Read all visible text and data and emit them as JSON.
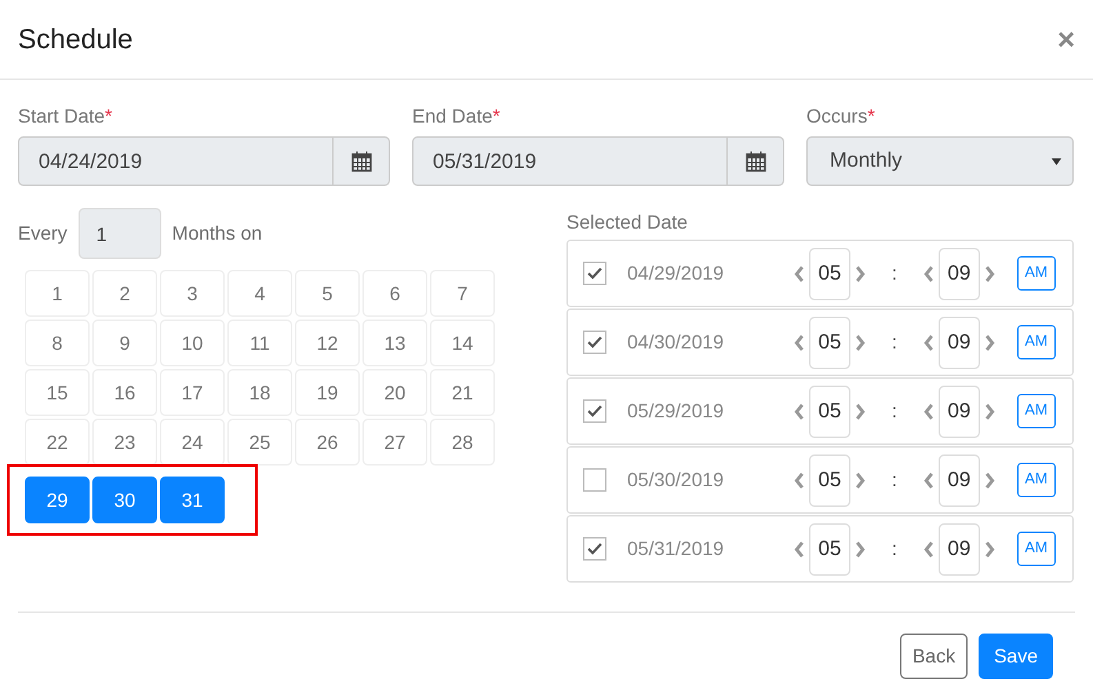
{
  "window": {
    "title": "Schedule",
    "close": "×"
  },
  "fields": [
    {
      "kind": "date",
      "label": "Start Date",
      "required_mark": "*",
      "value": "04/24/2019"
    },
    {
      "kind": "date",
      "label": "End Date",
      "required_mark": "*",
      "value": "05/31/2019"
    },
    {
      "kind": "select",
      "label": "Occurs",
      "required_mark": "*",
      "value": "Monthly"
    }
  ],
  "every": {
    "prefix": "Every",
    "value": "1",
    "suffix": "Months on"
  },
  "calendar": {
    "highlight_selected": true,
    "days": [
      {
        "label": "1",
        "selected": false
      },
      {
        "label": "2",
        "selected": false
      },
      {
        "label": "3",
        "selected": false
      },
      {
        "label": "4",
        "selected": false
      },
      {
        "label": "5",
        "selected": false
      },
      {
        "label": "6",
        "selected": false
      },
      {
        "label": "7",
        "selected": false
      },
      {
        "label": "8",
        "selected": false
      },
      {
        "label": "9",
        "selected": false
      },
      {
        "label": "10",
        "selected": false
      },
      {
        "label": "11",
        "selected": false
      },
      {
        "label": "12",
        "selected": false
      },
      {
        "label": "13",
        "selected": false
      },
      {
        "label": "14",
        "selected": false
      },
      {
        "label": "15",
        "selected": false
      },
      {
        "label": "16",
        "selected": false
      },
      {
        "label": "17",
        "selected": false
      },
      {
        "label": "18",
        "selected": false
      },
      {
        "label": "19",
        "selected": false
      },
      {
        "label": "20",
        "selected": false
      },
      {
        "label": "21",
        "selected": false
      },
      {
        "label": "22",
        "selected": false
      },
      {
        "label": "23",
        "selected": false
      },
      {
        "label": "24",
        "selected": false
      },
      {
        "label": "25",
        "selected": false
      },
      {
        "label": "26",
        "selected": false
      },
      {
        "label": "27",
        "selected": false
      },
      {
        "label": "28",
        "selected": false
      },
      {
        "label": "29",
        "selected": true
      },
      {
        "label": "30",
        "selected": true
      },
      {
        "label": "31",
        "selected": true
      }
    ]
  },
  "selected_dates": {
    "title": "Selected Date",
    "rows": [
      {
        "checked": true,
        "date": "04/29/2019",
        "hour": "05",
        "separator": ":",
        "minute": "09",
        "period": "AM"
      },
      {
        "checked": true,
        "date": "04/30/2019",
        "hour": "05",
        "separator": ":",
        "minute": "09",
        "period": "AM"
      },
      {
        "checked": true,
        "date": "05/29/2019",
        "hour": "05",
        "separator": ":",
        "minute": "09",
        "period": "AM"
      },
      {
        "checked": false,
        "date": "05/30/2019",
        "hour": "05",
        "separator": ":",
        "minute": "09",
        "period": "AM"
      },
      {
        "checked": true,
        "date": "05/31/2019",
        "hour": "05",
        "separator": ":",
        "minute": "09",
        "period": "AM"
      }
    ]
  },
  "buttons": [
    {
      "kind": "secondary",
      "label": "Back"
    },
    {
      "kind": "primary",
      "label": "Save"
    }
  ]
}
